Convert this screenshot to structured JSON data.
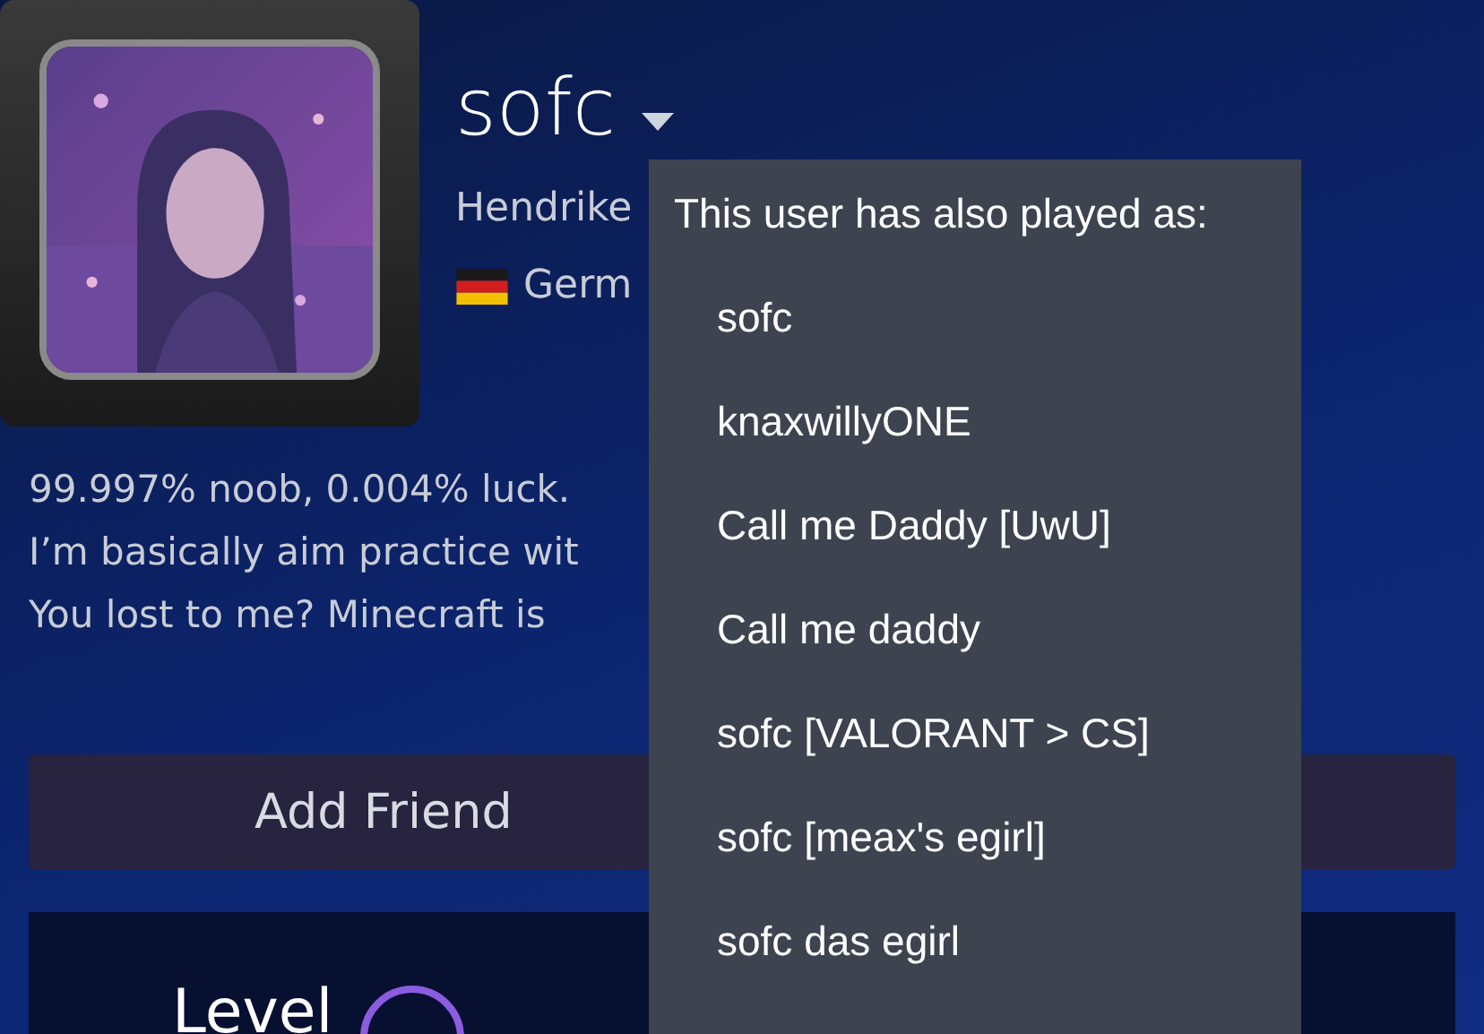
{
  "profile": {
    "name": "sofc",
    "real_name": "Hendrike",
    "country": "Germ",
    "summary": [
      "99.997% noob, 0.004% luck.",
      "I’m basically aim practice wit",
      "You lost to me? Minecraft is"
    ]
  },
  "add_friend_button": "Add Friend",
  "level_panel": {
    "label": "Level"
  },
  "aliases_menu": {
    "title": "This user has also played as:",
    "items": [
      "sofc",
      "knaxwillyONE",
      "Call me Daddy [UwU]",
      "Call me daddy",
      "sofc [VALORANT > CS]",
      "sofc [meax's egirl]",
      "sofc das egirl"
    ]
  }
}
